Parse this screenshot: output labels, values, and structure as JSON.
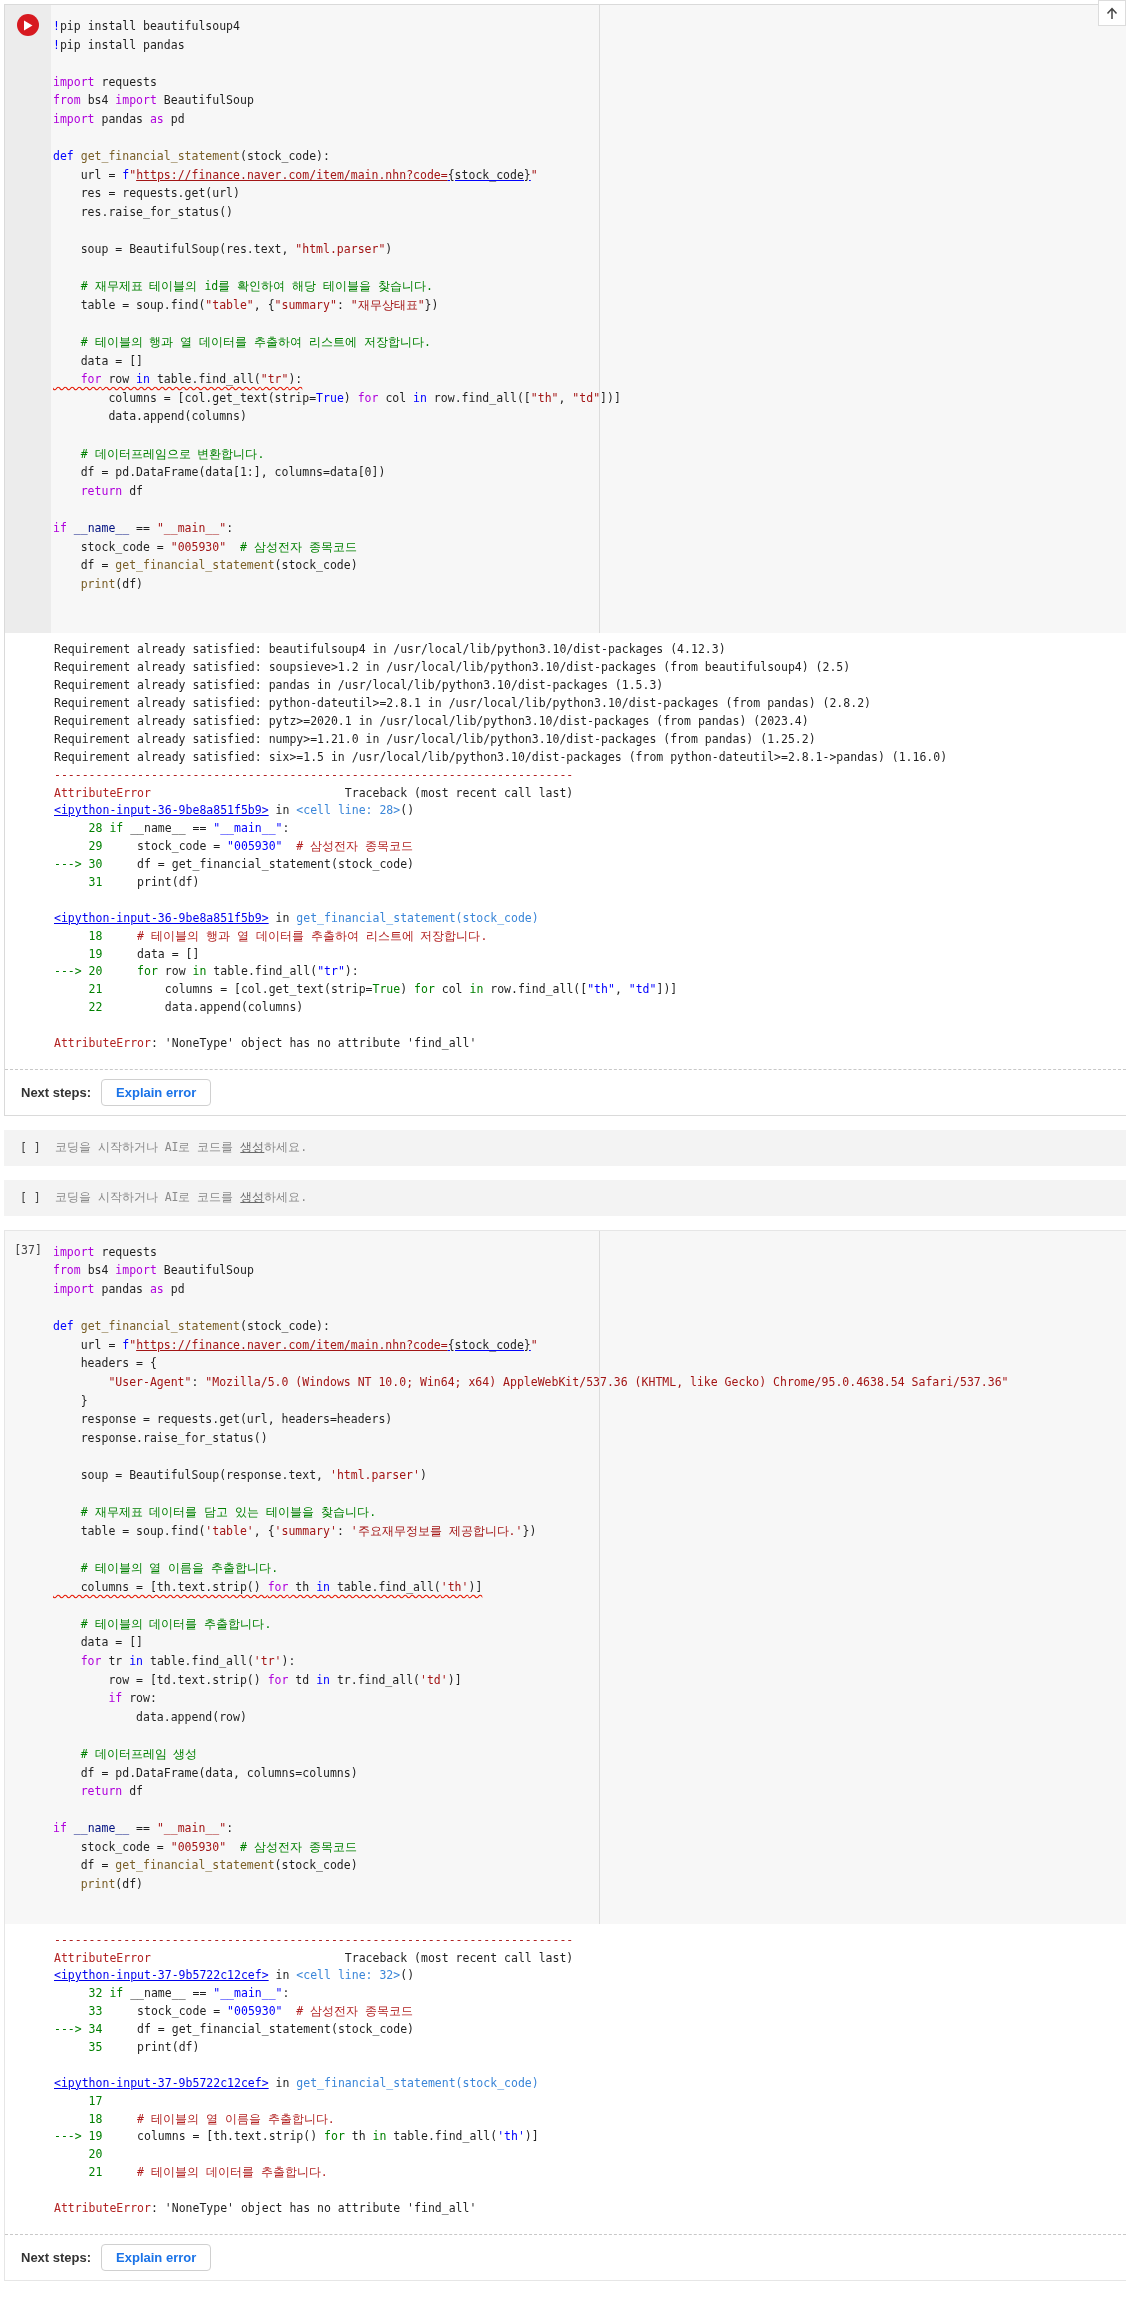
{
  "cells": [
    {
      "kind": "code",
      "focused": true,
      "code": {
        "blocks": [
          [
            [
              {
                "kind": "magic",
                "text": "!"
              },
              "pip install beautifulsoup4"
            ],
            [
              {
                "kind": "magic",
                "text": "!"
              },
              "pip install pandas"
            ]
          ],
          [
            [
              {
                "kind": "keyword",
                "text": "import"
              },
              " requests"
            ],
            [
              {
                "kind": "keyword",
                "text": "from"
              },
              " bs4 ",
              {
                "kind": "keyword",
                "text": "import"
              },
              " BeautifulSoup"
            ],
            [
              {
                "kind": "keyword",
                "text": "import"
              },
              " pandas ",
              {
                "kind": "keyword",
                "text": "as"
              },
              " pd"
            ]
          ],
          [
            [
              {
                "kind": "def",
                "text": "def "
              },
              {
                "kind": "function",
                "text": "get_financial_statement"
              },
              "(stock_code):"
            ],
            [
              "    url = ",
              {
                "kind": "def",
                "text": "f"
              },
              {
                "kind": "string",
                "text": "\""
              },
              {
                "kind": "url",
                "text": "https://finance.naver.com/item/main.nhn?code="
              },
              {
                "kind": "url_var",
                "text": "{stock_code}"
              },
              {
                "kind": "string",
                "text": "\""
              }
            ],
            [
              "    res = requests.get(url)"
            ],
            [
              "    res.raise_for_status()"
            ]
          ],
          [
            [
              "    soup = BeautifulSoup(res.text, ",
              {
                "kind": "string",
                "text": "\"html.parser\""
              },
              ")"
            ]
          ],
          [
            [
              {
                "kind": "comment",
                "text": "    # 재무제표 테이블의 id를 확인하여 해당 테이블을 찾습니다."
              }
            ],
            [
              "    table = soup.find(",
              {
                "kind": "string",
                "text": "\"table\""
              },
              ", {",
              {
                "kind": "string",
                "text": "\"summary\""
              },
              ": ",
              {
                "kind": "string",
                "text": "\"재무상태표\""
              },
              "})"
            ]
          ],
          [
            [
              {
                "kind": "comment",
                "text": "    # 테이블의 행과 열 데이터를 추출하여 리스트에 저장합니다."
              }
            ],
            [
              "    data = []"
            ],
            {
              "squiggle": true,
              "segments": [
                {
                  "kind": "keyword",
                  "text": "    for"
                },
                " row ",
                {
                  "kind": "def",
                  "text": "in"
                },
                " table.find_all(",
                {
                  "kind": "string",
                  "text": "\"tr\""
                },
                "):"
              ]
            },
            [
              "        columns = [col.get_text(strip=",
              {
                "kind": "constant",
                "text": "True"
              },
              ") ",
              {
                "kind": "keyword",
                "text": "for"
              },
              " col ",
              {
                "kind": "def",
                "text": "in"
              },
              " row.find_all([",
              {
                "kind": "string",
                "text": "\"th\""
              },
              ", ",
              {
                "kind": "string",
                "text": "\"td\""
              },
              "])]"
            ],
            [
              "        data.append(columns)"
            ]
          ],
          [
            [
              {
                "kind": "comment",
                "text": "    # 데이터프레임으로 변환합니다."
              }
            ],
            [
              "    df = pd.DataFrame(data[1:], columns=data[0])"
            ],
            [
              {
                "kind": "keyword",
                "text": "    return"
              },
              " df"
            ]
          ],
          [
            [
              {
                "kind": "keyword",
                "text": "if "
              },
              {
                "kind": "variable",
                "text": "__name__"
              },
              " == ",
              {
                "kind": "string",
                "text": "\"__main__\""
              },
              ":"
            ],
            [
              "    stock_code = ",
              {
                "kind": "string",
                "text": "\"005930\""
              },
              {
                "kind": "comment",
                "text": "  # 삼성전자 종목코드"
              }
            ],
            [
              "    df = ",
              {
                "kind": "function",
                "text": "get_financial_statement"
              },
              "(stock_code)"
            ],
            [
              {
                "kind": "function",
                "text": "    print"
              },
              "(df)"
            ]
          ]
        ]
      },
      "output": {
        "blocks": [
          [
            [
              "Requirement already satisfied: beautifulsoup4 in /usr/local/lib/python3.10/dist-packages (4.12.3)"
            ],
            [
              "Requirement already satisfied: soupsieve>1.2 in /usr/local/lib/python3.10/dist-packages (from beautifulsoup4) (2.5)"
            ],
            [
              "Requirement already satisfied: pandas in /usr/local/lib/python3.10/dist-packages (1.5.3)"
            ],
            [
              "Requirement already satisfied: python-dateutil>=2.8.1 in /usr/local/lib/python3.10/dist-packages (from pandas) (2.8.2)"
            ],
            [
              "Requirement already satisfied: pytz>=2020.1 in /usr/local/lib/python3.10/dist-packages (from pandas) (2023.4)"
            ],
            [
              "Requirement already satisfied: numpy>=1.21.0 in /usr/local/lib/python3.10/dist-packages (from pandas) (1.25.2)"
            ],
            [
              "Requirement already satisfied: six>=1.5 in /usr/local/lib/python3.10/dist-packages (from python-dateutil>=2.8.1->pandas) (1.16.0)"
            ],
            [
              {
                "kind": "error",
                "text": "---------------------------------------------------------------------------"
              }
            ],
            [
              {
                "kind": "error",
                "text": "AttributeError"
              },
              "                            Traceback (most recent call last)"
            ],
            [
              {
                "kind": "link",
                "text": "<ipython-input-36-9be8a851f5b9>"
              },
              " in ",
              {
                "kind": "cell_ref",
                "text": "<cell line: 28>"
              },
              "()"
            ],
            [
              {
                "kind": "lineno",
                "text": "     28 "
              },
              {
                "kind": "tb_keyword",
                "text": "if"
              },
              " __name__ == ",
              {
                "kind": "tb_string",
                "text": "\"__main__\""
              },
              ":"
            ],
            [
              {
                "kind": "lineno",
                "text": "     29     "
              },
              "stock_code = ",
              {
                "kind": "tb_string",
                "text": "\"005930\""
              },
              {
                "kind": "tb_comment",
                "text": "  # 삼성전자 종목코드"
              }
            ],
            [
              {
                "kind": "lineno",
                "text": "---> 30     "
              },
              "df = get_financial_statement(stock_code)"
            ],
            [
              {
                "kind": "lineno",
                "text": "     31     "
              },
              "print(df)"
            ]
          ],
          [
            [
              {
                "kind": "link",
                "text": "<ipython-input-36-9be8a851f5b9>"
              },
              " in ",
              {
                "kind": "cell_ref",
                "text": "get_financial_statement(stock_code)"
              }
            ],
            [
              {
                "kind": "lineno",
                "text": "     18     "
              },
              {
                "kind": "tb_comment",
                "text": "# 테이블의 행과 열 데이터를 추출하여 리스트에 저장합니다."
              }
            ],
            [
              {
                "kind": "lineno",
                "text": "     19     "
              },
              "data = []"
            ],
            [
              {
                "kind": "lineno",
                "text": "---> 20     "
              },
              {
                "kind": "tb_keyword",
                "text": "for"
              },
              " row ",
              {
                "kind": "tb_keyword",
                "text": "in"
              },
              " table.find_all(",
              {
                "kind": "tb_string",
                "text": "\"tr\""
              },
              "):"
            ],
            [
              {
                "kind": "lineno",
                "text": "     21         "
              },
              "columns = [col.get_text(strip=",
              {
                "kind": "tb_keyword",
                "text": "True"
              },
              ") ",
              {
                "kind": "tb_keyword",
                "text": "for"
              },
              " col ",
              {
                "kind": "tb_keyword",
                "text": "in"
              },
              " row.find_all([",
              {
                "kind": "tb_string",
                "text": "\"th\""
              },
              ", ",
              {
                "kind": "tb_string",
                "text": "\"td\""
              },
              "])]"
            ],
            [
              {
                "kind": "lineno",
                "text": "     22         "
              },
              "data.append(columns)"
            ]
          ],
          [
            [
              {
                "kind": "error",
                "text": "AttributeError"
              },
              ": 'NoneType' object has no attribute 'find_all'"
            ]
          ]
        ]
      },
      "next_steps": {
        "label": "Next steps:",
        "button": "Explain error"
      }
    },
    {
      "kind": "empty",
      "prompt": "[ ]",
      "placeholder": "코딩을 시작하거나 AI로 코드를 ",
      "link": "생성",
      "placeholder_end": "하세요."
    },
    {
      "kind": "empty",
      "prompt": "[ ]",
      "placeholder": "코딩을 시작하거나 AI로 코드를 ",
      "link": "생성",
      "placeholder_end": "하세요."
    },
    {
      "kind": "code",
      "focused": false,
      "prompt": "[37]",
      "code": {
        "blocks": [
          [
            [
              {
                "kind": "keyword",
                "text": "import"
              },
              " requests"
            ],
            [
              {
                "kind": "keyword",
                "text": "from"
              },
              " bs4 ",
              {
                "kind": "keyword",
                "text": "import"
              },
              " BeautifulSoup"
            ],
            [
              {
                "kind": "keyword",
                "text": "import"
              },
              " pandas ",
              {
                "kind": "keyword",
                "text": "as"
              },
              " pd"
            ]
          ],
          [
            [
              {
                "kind": "def",
                "text": "def "
              },
              {
                "kind": "function",
                "text": "get_financial_statement"
              },
              "(stock_code):"
            ],
            [
              "    url = ",
              {
                "kind": "def",
                "text": "f"
              },
              {
                "kind": "string",
                "text": "\""
              },
              {
                "kind": "url",
                "text": "https://finance.naver.com/item/main.nhn?code="
              },
              {
                "kind": "url_var",
                "text": "{stock_code}"
              },
              {
                "kind": "string",
                "text": "\""
              }
            ],
            [
              "    headers = {"
            ],
            [
              {
                "kind": "string",
                "text": "        \"User-Agent\""
              },
              ": ",
              {
                "kind": "string",
                "text": "\"Mozilla/5.0 (Windows NT 10.0; Win64; x64) AppleWebKit/537.36 (KHTML, like Gecko) Chrome/95.0.4638.54 Safari/537.36\""
              }
            ],
            [
              "    }"
            ],
            [
              "    response = requests.get(url, headers=headers)"
            ],
            [
              "    response.raise_for_status()"
            ]
          ],
          [
            [
              "    soup = BeautifulSoup(response.text, ",
              {
                "kind": "string",
                "text": "'html.parser'"
              },
              ")"
            ]
          ],
          [
            [
              {
                "kind": "comment",
                "text": "    # 재무제표 데이터를 담고 있는 테이블을 찾습니다."
              }
            ],
            [
              "    table = soup.find(",
              {
                "kind": "string",
                "text": "'table'"
              },
              ", {",
              {
                "kind": "string",
                "text": "'summary'"
              },
              ": ",
              {
                "kind": "string",
                "text": "'주요재무정보를 제공합니다.'"
              },
              "})"
            ]
          ],
          [
            [
              {
                "kind": "comment",
                "text": "    # 테이블의 열 이름을 추출합니다."
              }
            ],
            {
              "squiggle": true,
              "segments": [
                "    columns = [th.text.strip() ",
                {
                  "kind": "keyword",
                  "text": "for"
                },
                " th ",
                {
                  "kind": "def",
                  "text": "in"
                },
                " table.find_all(",
                {
                  "kind": "string",
                  "text": "'th'"
                },
                ")]"
              ]
            }
          ],
          [
            [
              {
                "kind": "comment",
                "text": "    # 테이블의 데이터를 추출합니다."
              }
            ],
            [
              "    data = []"
            ],
            [
              {
                "kind": "keyword",
                "text": "    for"
              },
              " tr ",
              {
                "kind": "def",
                "text": "in"
              },
              " table.find_all(",
              {
                "kind": "string",
                "text": "'tr'"
              },
              "):"
            ],
            [
              "        row = [td.text.strip() ",
              {
                "kind": "keyword",
                "text": "for"
              },
              " td ",
              {
                "kind": "def",
                "text": "in"
              },
              " tr.find_all(",
              {
                "kind": "string",
                "text": "'td'"
              },
              ")]"
            ],
            [
              {
                "kind": "keyword",
                "text": "        if"
              },
              " row:"
            ],
            [
              "            data.append(row)"
            ]
          ],
          [
            [
              {
                "kind": "comment",
                "text": "    # 데이터프레임 생성"
              }
            ],
            [
              "    df = pd.DataFrame(data, columns=columns)"
            ],
            [
              {
                "kind": "keyword",
                "text": "    return"
              },
              " df"
            ]
          ],
          [
            [
              {
                "kind": "keyword",
                "text": "if "
              },
              {
                "kind": "variable",
                "text": "__name__"
              },
              " == ",
              {
                "kind": "string",
                "text": "\"__main__\""
              },
              ":"
            ],
            [
              "    stock_code = ",
              {
                "kind": "string",
                "text": "\"005930\""
              },
              {
                "kind": "comment",
                "text": "  # 삼성전자 종목코드"
              }
            ],
            [
              "    df = ",
              {
                "kind": "function",
                "text": "get_financial_statement"
              },
              "(stock_code)"
            ],
            [
              {
                "kind": "function",
                "text": "    print"
              },
              "(df)"
            ]
          ]
        ]
      },
      "output": {
        "blocks": [
          [
            [
              {
                "kind": "error",
                "text": "---------------------------------------------------------------------------"
              }
            ],
            [
              {
                "kind": "error",
                "text": "AttributeError"
              },
              "                            Traceback (most recent call last)"
            ],
            [
              {
                "kind": "link",
                "text": "<ipython-input-37-9b5722c12cef>"
              },
              " in ",
              {
                "kind": "cell_ref",
                "text": "<cell line: 32>"
              },
              "()"
            ],
            [
              {
                "kind": "lineno",
                "text": "     32 "
              },
              {
                "kind": "tb_keyword",
                "text": "if"
              },
              " __name__ == ",
              {
                "kind": "tb_string",
                "text": "\"__main__\""
              },
              ":"
            ],
            [
              {
                "kind": "lineno",
                "text": "     33     "
              },
              "stock_code = ",
              {
                "kind": "tb_string",
                "text": "\"005930\""
              },
              {
                "kind": "tb_comment",
                "text": "  # 삼성전자 종목코드"
              }
            ],
            [
              {
                "kind": "lineno",
                "text": "---> 34     "
              },
              "df = get_financial_statement(stock_code)"
            ],
            [
              {
                "kind": "lineno",
                "text": "     35     "
              },
              "print(df)"
            ]
          ],
          [
            [
              {
                "kind": "link",
                "text": "<ipython-input-37-9b5722c12cef>"
              },
              " in ",
              {
                "kind": "cell_ref",
                "text": "get_financial_statement(stock_code)"
              }
            ],
            [
              {
                "kind": "lineno",
                "text": "     17"
              }
            ],
            [
              {
                "kind": "lineno",
                "text": "     18     "
              },
              {
                "kind": "tb_comment",
                "text": "# 테이블의 열 이름을 추출합니다."
              }
            ],
            [
              {
                "kind": "lineno",
                "text": "---> 19     "
              },
              "columns = [th.text.strip() ",
              {
                "kind": "tb_keyword",
                "text": "for"
              },
              " th ",
              {
                "kind": "tb_keyword",
                "text": "in"
              },
              " table.find_all(",
              {
                "kind": "tb_string",
                "text": "'th'"
              },
              ")]"
            ],
            [
              {
                "kind": "lineno",
                "text": "     20"
              }
            ],
            [
              {
                "kind": "lineno",
                "text": "     21     "
              },
              {
                "kind": "tb_comment",
                "text": "# 테이블의 데이터를 추출합니다."
              }
            ]
          ],
          [
            [
              {
                "kind": "error",
                "text": "AttributeError"
              },
              ": 'NoneType' object has no attribute 'find_all'"
            ]
          ]
        ]
      },
      "next_steps": {
        "label": "Next steps:",
        "button": "Explain error"
      }
    }
  ]
}
